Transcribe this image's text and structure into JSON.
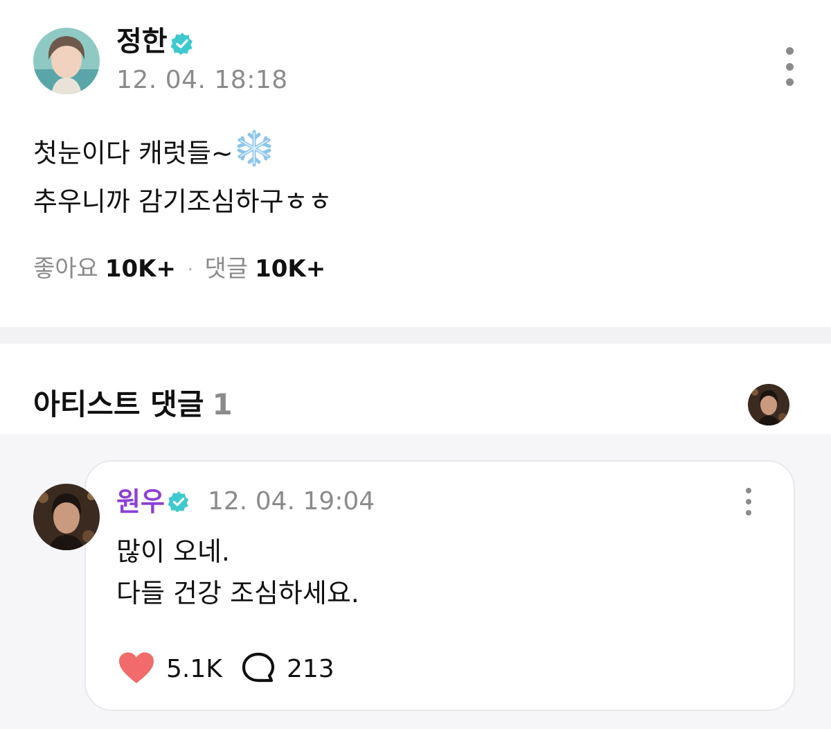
{
  "post": {
    "author": {
      "name": "정한",
      "verified": true,
      "avatar": "profile-photo"
    },
    "timestamp": "12. 04. 18:18",
    "body_lines": [
      "첫눈이다 캐럿들~",
      "추우니까 감기조심하구ㅎㅎ"
    ],
    "body_emoji": "snowflake-icon",
    "stats": {
      "likes_label": "좋아요",
      "likes_value": "10K+",
      "separator": "·",
      "comments_label": "댓글",
      "comments_value": "10K+"
    }
  },
  "artist_comments": {
    "title": "아티스트 댓글",
    "count": "1",
    "comment": {
      "author": {
        "name": "원우",
        "verified": true,
        "avatar": "profile-photo"
      },
      "timestamp": "12. 04. 19:04",
      "body_lines": [
        "많이 오네.",
        "다들 건강 조심하세요."
      ],
      "likes": "5.1K",
      "replies": "213"
    }
  },
  "colors": {
    "verified_badge": "#3ec9cf",
    "comment_author": "#8c3fd6",
    "heart": "#f26b6b",
    "muted_text": "#8b8b8b",
    "divider": "#f2f2f4",
    "comment_background": "#f6f6f9"
  }
}
